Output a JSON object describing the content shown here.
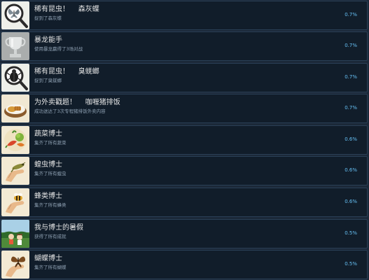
{
  "achievements": [
    {
      "title": "稀有昆虫！    森灰蝶",
      "desc": "捉到了森灰蝶",
      "pct": "0.7%",
      "icon": "magnifier-butterfly-icon"
    },
    {
      "title": "暴龙能手",
      "desc": "使用暴龙赢得了3场对战",
      "pct": "0.7%",
      "icon": "trophy-icon"
    },
    {
      "title": "稀有昆虫！    臭蜣螂",
      "desc": "捉到了臭蜣螂",
      "pct": "0.7%",
      "icon": "magnifier-beetle-icon"
    },
    {
      "title": "为外卖戳题！    咖喱猪排饭",
      "desc": "成功送达了3次专程猪排饭外卖内容",
      "pct": "0.7%",
      "icon": "curry-bowl-icon"
    },
    {
      "title": "蔬菜博士",
      "desc": "集齐了所有蔬菜",
      "pct": "0.6%",
      "icon": "vegetables-icon"
    },
    {
      "title": "蝗虫博士",
      "desc": "集齐了所有蝗虫",
      "pct": "0.6%",
      "icon": "grasshopper-hand-icon"
    },
    {
      "title": "蜂类博士",
      "desc": "集齐了所有蜂类",
      "pct": "0.6%",
      "icon": "bee-hand-icon"
    },
    {
      "title": "我与博士的暑假",
      "desc": "获得了所有成就",
      "pct": "0.5%",
      "icon": "summer-scene-icon"
    },
    {
      "title": "蝴蝶博士",
      "desc": "集齐了所有蝴蝶",
      "pct": "0.5%",
      "icon": "butterfly-hand-icon"
    }
  ]
}
